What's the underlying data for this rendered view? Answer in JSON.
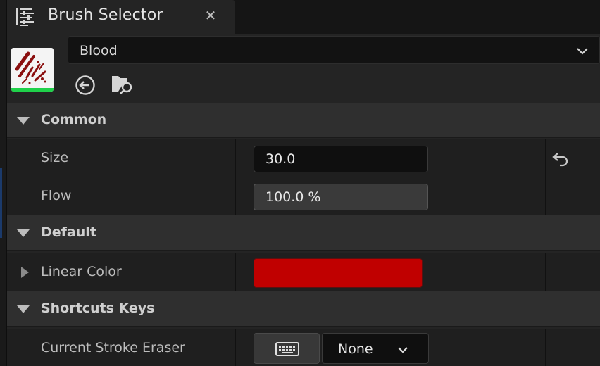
{
  "tab": {
    "title": "Brush Selector",
    "close_glyph": "✕",
    "icon": "details-panel-icon"
  },
  "brush": {
    "selected": "Blood",
    "thumbnail_icon": "brush-thumbnail",
    "accent_color": "#1fd14a"
  },
  "sections": {
    "common": {
      "title": "Common",
      "size_label": "Size",
      "size_value": "30.0",
      "flow_label": "Flow",
      "flow_value": "100.0 %"
    },
    "default": {
      "title": "Default",
      "linear_color_label": "Linear Color",
      "linear_color_value": "#c00000"
    },
    "shortcuts": {
      "title": "Shortcuts Keys",
      "eraser_label": "Current Stroke Eraser",
      "eraser_value": "None"
    }
  }
}
